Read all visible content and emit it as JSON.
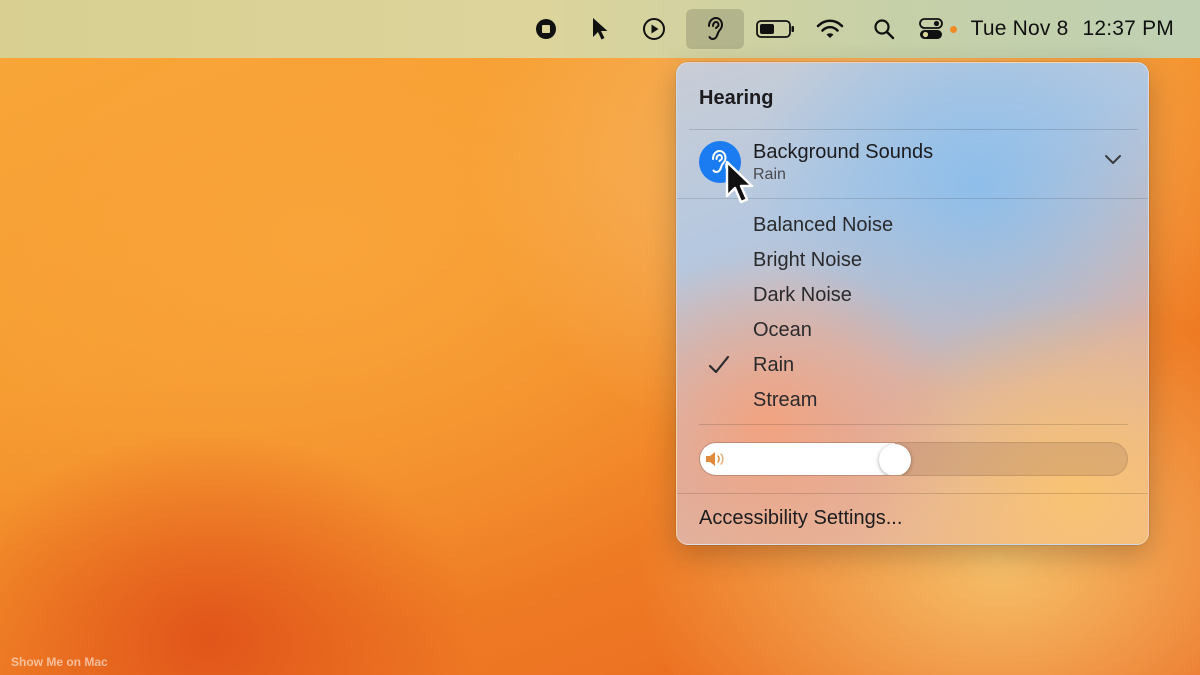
{
  "menubar": {
    "items": [
      {
        "name": "stop-recording-icon"
      },
      {
        "name": "pointer-icon"
      },
      {
        "name": "play-icon"
      },
      {
        "name": "hearing-icon",
        "active": true
      },
      {
        "name": "battery-icon",
        "level": 0.5
      },
      {
        "name": "wifi-icon"
      },
      {
        "name": "spotlight-search-icon"
      },
      {
        "name": "control-center-icon"
      }
    ],
    "date": "Tue Nov 8",
    "time": "12:37 PM"
  },
  "panel": {
    "title": "Hearing",
    "background_sounds": {
      "label": "Background Sounds",
      "current": "Rain"
    },
    "sounds": [
      {
        "label": "Balanced Noise",
        "selected": false
      },
      {
        "label": "Bright Noise",
        "selected": false
      },
      {
        "label": "Dark Noise",
        "selected": false
      },
      {
        "label": "Ocean",
        "selected": false
      },
      {
        "label": "Rain",
        "selected": true
      },
      {
        "label": "Stream",
        "selected": false
      }
    ],
    "volume": 0.45,
    "settings_label": "Accessibility Settings..."
  },
  "watermark": "Show Me on Mac",
  "colors": {
    "accent": "#1a7cf0",
    "recording_dot": "#f08a24"
  }
}
